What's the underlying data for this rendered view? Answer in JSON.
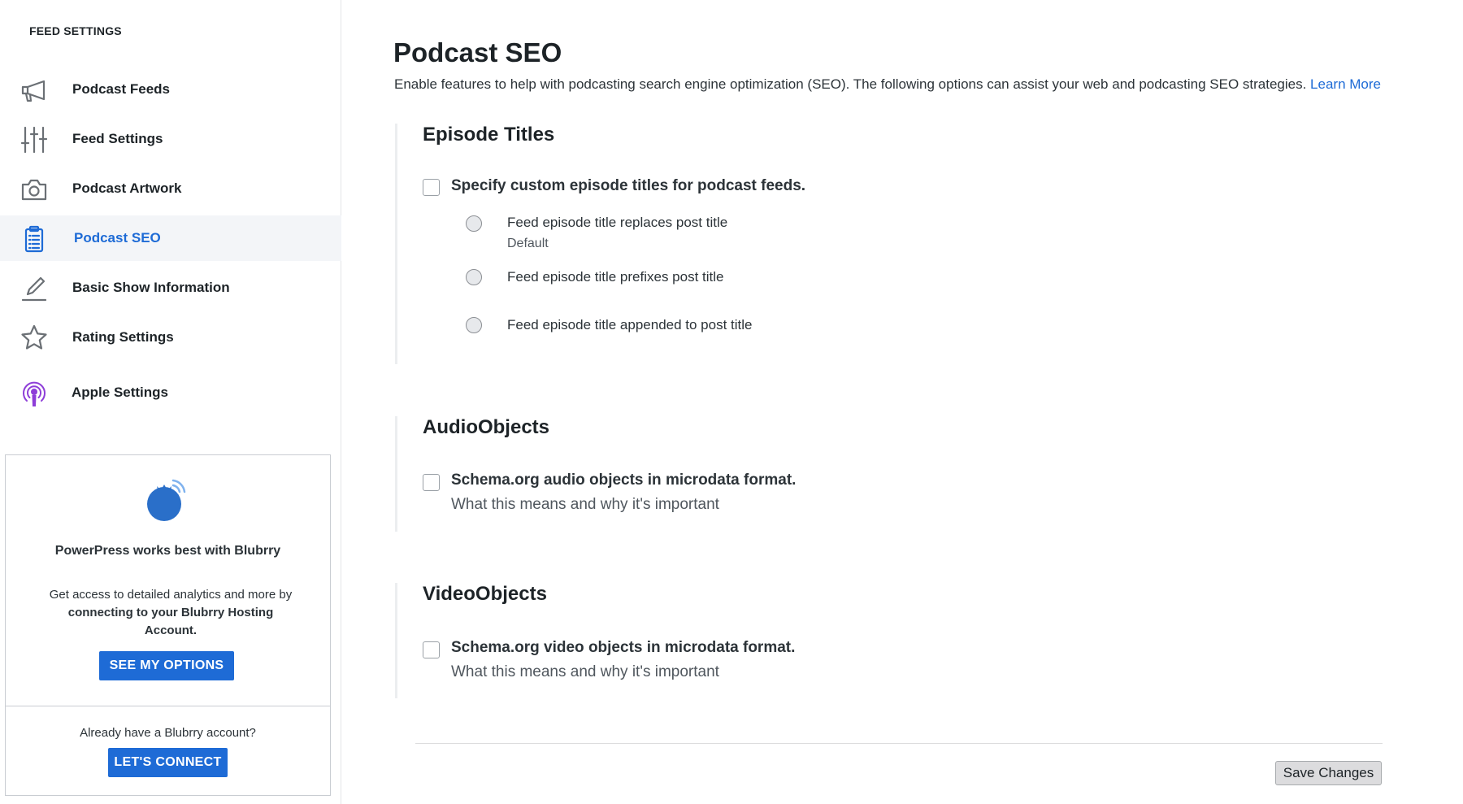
{
  "sidebar": {
    "title": "FEED SETTINGS",
    "items": [
      {
        "label": "Podcast Feeds",
        "icon": "megaphone-icon",
        "active": false
      },
      {
        "label": "Feed Settings",
        "icon": "sliders-icon",
        "active": false
      },
      {
        "label": "Podcast Artwork",
        "icon": "camera-icon",
        "active": false
      },
      {
        "label": "Podcast SEO",
        "icon": "clipboard-icon",
        "active": true
      },
      {
        "label": "Basic Show Information",
        "icon": "pencil-icon",
        "active": false
      },
      {
        "label": "Rating Settings",
        "icon": "star-icon",
        "active": false
      },
      {
        "label": "Apple Settings",
        "icon": "apple-podcasts-icon",
        "active": false
      }
    ],
    "promo": {
      "logo_icon": "blubrry-logo-icon",
      "heading": "PowerPress works best with Blubrry",
      "text_before": "Get access to detailed analytics and more by ",
      "text_bold": "connecting to your Blubrry Hosting Account.",
      "options_button": "SEE MY OPTIONS",
      "already_text": "Already have a Blubrry account?",
      "connect_button": "LET'S CONNECT"
    }
  },
  "main": {
    "title": "Podcast SEO",
    "description": "Enable features to help with podcasting search engine optimization (SEO). The following options can assist your web and podcasting SEO strategies. ",
    "learn_more": "Learn More",
    "episode_titles": {
      "title": "Episode Titles",
      "checkbox_label": "Specify custom episode titles for podcast feeds.",
      "checked": false,
      "options": [
        {
          "label": "Feed episode title replaces post title",
          "sub": "Default"
        },
        {
          "label": "Feed episode title prefixes post title",
          "sub": ""
        },
        {
          "label": "Feed episode title appended to post title",
          "sub": ""
        }
      ]
    },
    "audio_objects": {
      "title": "AudioObjects",
      "checkbox_label": "Schema.org audio objects in microdata format.",
      "sub_link": "What this means and why it's important",
      "checked": false
    },
    "video_objects": {
      "title": "VideoObjects",
      "checkbox_label": "Schema.org video objects in microdata format.",
      "sub_link": "What this means and why it's important",
      "checked": false
    },
    "save_button": "Save Changes"
  },
  "colors": {
    "accent": "#1e6bd6",
    "active_bg": "#f3f5f8",
    "apple_purple": "#8e3ed8",
    "blubrry_blue": "#2a6fc9"
  }
}
